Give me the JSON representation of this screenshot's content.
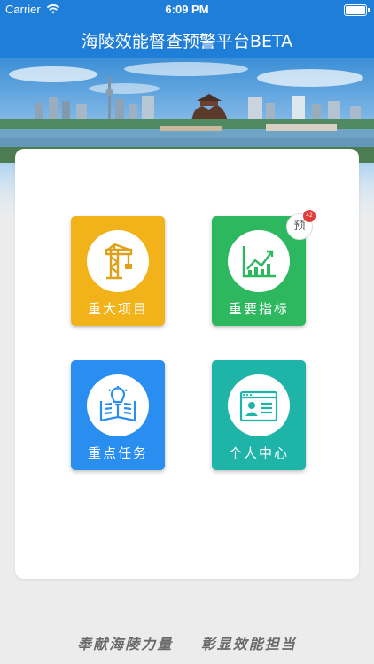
{
  "status_bar": {
    "carrier": "Carrier",
    "time": "6:09 PM"
  },
  "header": {
    "title": "海陵效能督查预警平台BETA"
  },
  "tiles": [
    {
      "label": "重大项目",
      "color": "#f2b21a",
      "icon": "tower-crane-icon"
    },
    {
      "label": "重要指标",
      "color": "#2db860",
      "icon": "growth-chart-icon",
      "badge_text": "预",
      "badge_count": "42"
    },
    {
      "label": "重点任务",
      "color": "#2a8ef0",
      "icon": "idea-book-icon"
    },
    {
      "label": "个人中心",
      "color": "#1fb4a8",
      "icon": "profile-card-icon"
    }
  ],
  "footer": {
    "slogan_left": "奉献海陵力量",
    "slogan_right": "彰显效能担当"
  },
  "colors": {
    "primary": "#1f7ed8",
    "background": "#ececec"
  }
}
